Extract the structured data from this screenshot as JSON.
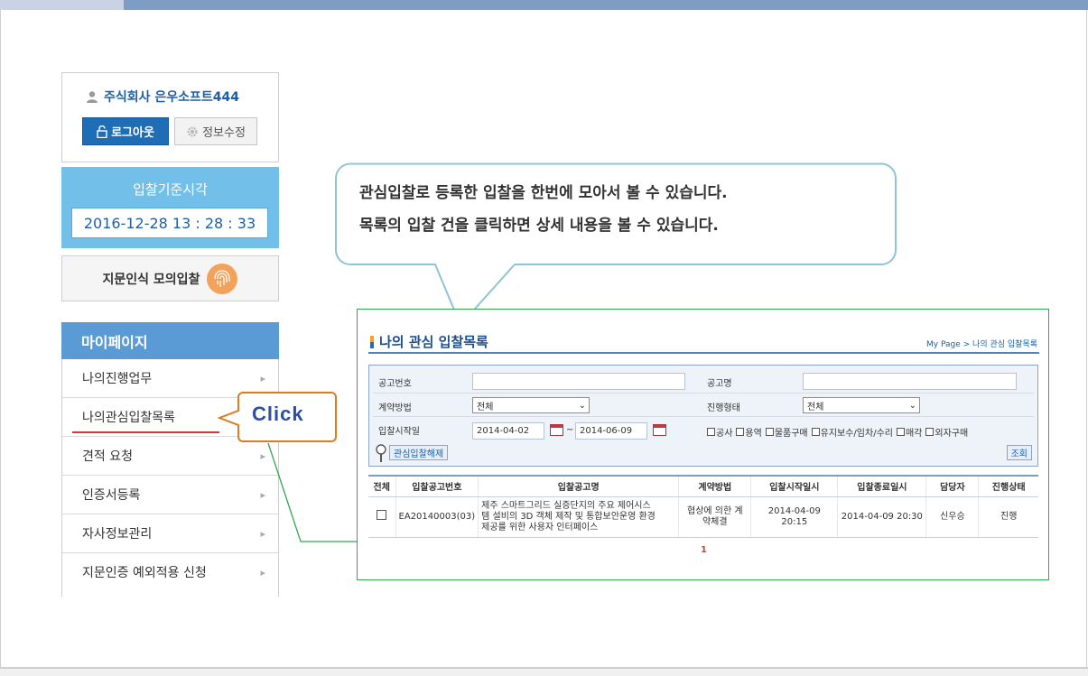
{
  "user": {
    "name": "주식회사 은우소프트444",
    "logout_label": "로그아웃",
    "edit_label": "정보수정"
  },
  "time": {
    "title": "입찰기준시각",
    "value": "2016-12-28 13 : 28 : 33"
  },
  "fingerprint": {
    "label": "지문인식 모의입찰"
  },
  "menu": {
    "header": "마이페이지",
    "items": [
      {
        "label": "나의진행업무"
      },
      {
        "label": "나의관심입찰목록"
      },
      {
        "label": "견적 요청"
      },
      {
        "label": "인증서등록"
      },
      {
        "label": "자사정보관리"
      },
      {
        "label": "지문인증 예외적용 신청"
      }
    ]
  },
  "callouts": {
    "click": "Click",
    "line1": "관심입찰로 등록한 입찰을 한번에 모아서 볼 수 있습니다.",
    "line2": "목록의 입찰 건을 클릭하면 상세 내용을 볼 수 있습니다."
  },
  "panel": {
    "title": "나의 관심 입찰목록",
    "breadcrumb": "My Page > 나의 관심 입찰목록",
    "search": {
      "notice_no_label": "공고번호",
      "notice_no_value": "",
      "notice_name_label": "공고명",
      "notice_name_value": "",
      "contract_method_label": "계약방법",
      "contract_method_value": "전체",
      "progress_type_label": "진행형태",
      "progress_type_value": "전체",
      "start_date_label": "입찰시작일",
      "date_from": "2014-04-02",
      "date_sep": "~",
      "date_to": "2014-06-09",
      "checkboxes": [
        "공사",
        "용역",
        "물품구매",
        "유지보수/임차/수리",
        "매각",
        "외자구매"
      ],
      "unregister_label": "관심입찰해제",
      "search_label": "조회"
    },
    "table": {
      "headers": [
        "전체",
        "입찰공고번호",
        "입찰공고명",
        "계약방법",
        "입찰시작일시",
        "입찰종료일시",
        "담당자",
        "진행상태"
      ],
      "rows": [
        {
          "notice_no": "EA20140003(03)",
          "name_line1": "제주 스마트그리드 실증단지의 주요 제어시스",
          "name_line2": "템 설비의 3D 객체 제작 및 통합보안운영 환경",
          "name_line3": "제공를 위한 사용자 인터페이스",
          "method_line1": "협상에 의한 계",
          "method_line2": "약체결",
          "start": "2014-04-09 20:15",
          "end": "2014-04-09 20:30",
          "manager": "신우승",
          "status": "진행"
        }
      ]
    },
    "pager": "1"
  }
}
